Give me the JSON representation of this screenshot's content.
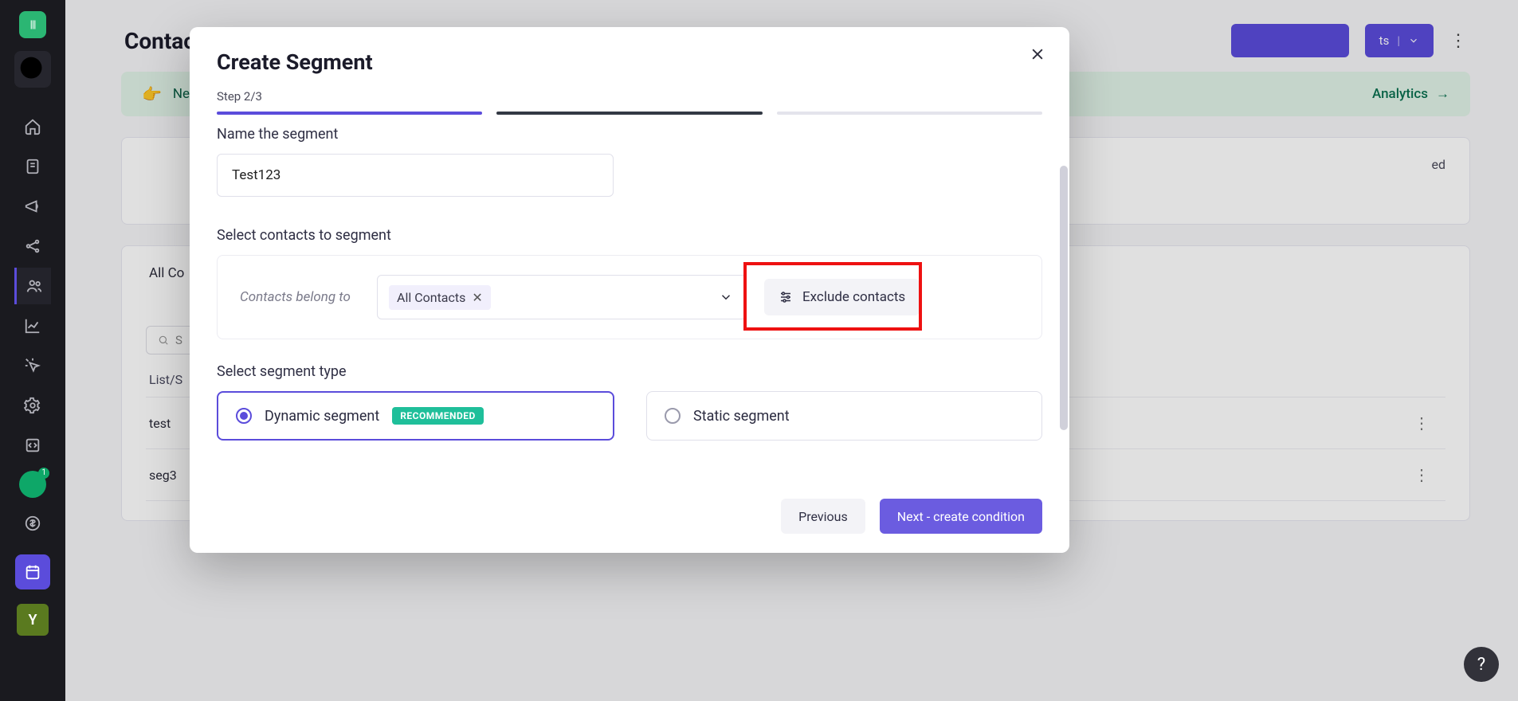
{
  "sidebar": {
    "logo_text": "|||",
    "y_label": "Y"
  },
  "page": {
    "title": "Contacts",
    "header_buttons": {
      "primary_label": "",
      "dropdown_suffix": "ts"
    },
    "banner": {
      "left": "New",
      "right": "Analytics",
      "arrow": "→"
    },
    "panel": {
      "right_text": "ed"
    },
    "tabs": {
      "all": "All Co"
    },
    "search_placeholder": "S",
    "list_header": {
      "col1": "List/S"
    },
    "rows": [
      "test",
      "seg3"
    ]
  },
  "modal": {
    "title": "Create Segment",
    "step_label": "Step 2/3",
    "name_section": "Name the segment",
    "name_value": "Test123",
    "contacts_section": "Select contacts to segment",
    "belong_label": "Contacts belong to",
    "contacts_chip": "All Contacts",
    "exclude_label": "Exclude contacts",
    "type_section": "Select segment type",
    "dynamic_label": "Dynamic segment",
    "recommended_badge": "RECOMMENDED",
    "static_label": "Static segment",
    "prev_btn": "Previous",
    "next_btn": "Next - create condition"
  },
  "help": "?"
}
